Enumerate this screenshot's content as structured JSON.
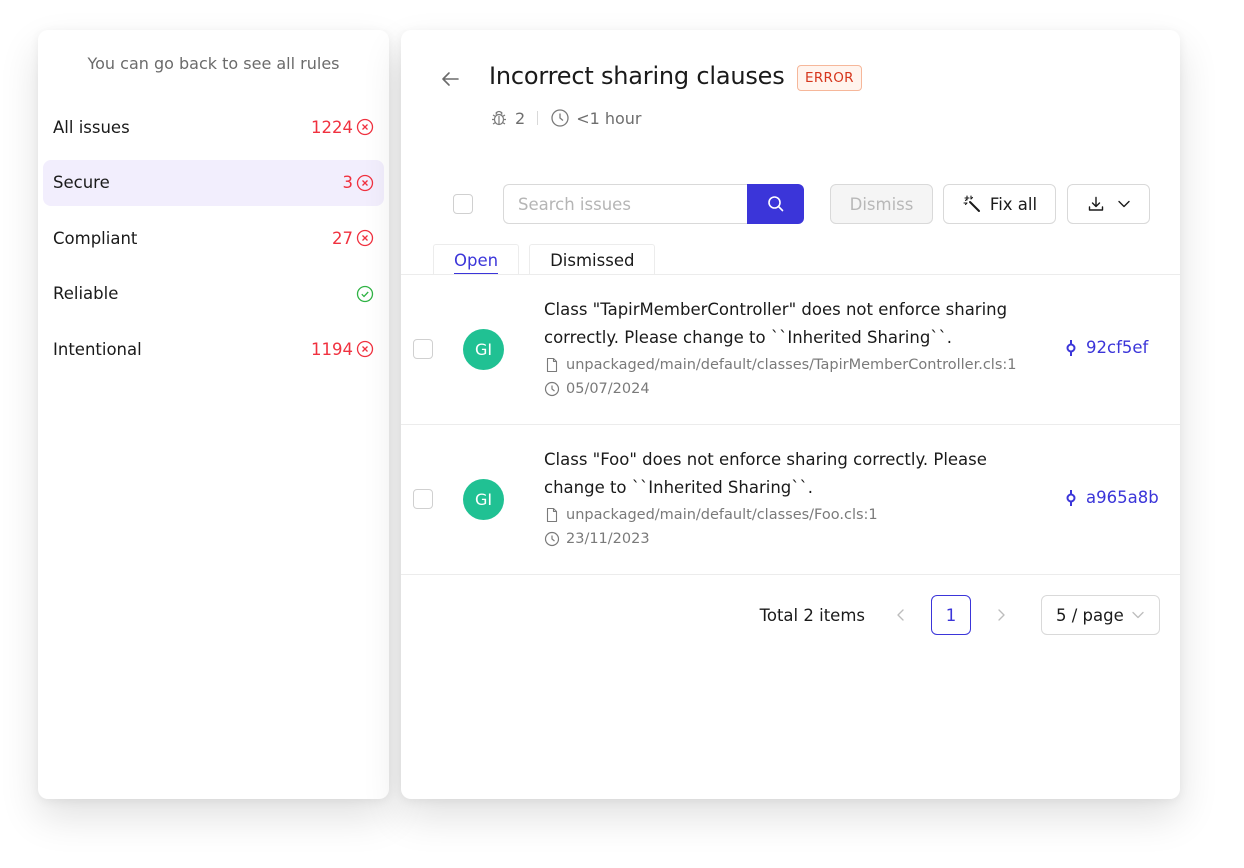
{
  "sidebar": {
    "hint": "You can go back to see all rules",
    "items": [
      {
        "label": "All issues",
        "count": "1224",
        "status": "error-icon",
        "active": false
      },
      {
        "label": "Secure",
        "count": "3",
        "status": "error-icon",
        "active": true
      },
      {
        "label": "Compliant",
        "count": "27",
        "status": "error-icon",
        "active": false
      },
      {
        "label": "Reliable",
        "count": "",
        "status": "check-icon",
        "active": false
      },
      {
        "label": "Intentional",
        "count": "1194",
        "status": "error-icon",
        "active": false
      }
    ]
  },
  "header": {
    "title": "Incorrect sharing clauses",
    "badge": "ERROR",
    "issue_count": "2",
    "duration": "<1 hour"
  },
  "toolbar": {
    "search_placeholder": "Search issues",
    "search_value": "",
    "dismiss_label": "Dismiss",
    "fix_all_label": "Fix all"
  },
  "tabs": [
    {
      "label": "Open",
      "active": true
    },
    {
      "label": "Dismissed",
      "active": false
    }
  ],
  "issues": [
    {
      "avatar": "GI",
      "message": "Class \"TapirMemberController\" does not enforce sharing correctly. Please change to ``Inherited Sharing``.",
      "file": "unpackaged/main/default/classes/TapirMemberController.cls:1",
      "date": "05/07/2024",
      "commit": "92cf5ef"
    },
    {
      "avatar": "GI",
      "message": "Class \"Foo\" does not enforce sharing correctly. Please change to ``Inherited Sharing``.",
      "file": "unpackaged/main/default/classes/Foo.cls:1",
      "date": "23/11/2023",
      "commit": "a965a8b"
    }
  ],
  "pagination": {
    "total": "Total 2 items",
    "current_page": "1",
    "page_size": "5 / page"
  },
  "colors": {
    "accent": "#3b35d9",
    "error": "#f0313f",
    "success": "#2fb344",
    "avatar": "#20c193",
    "active_bg": "#f2eefd"
  }
}
